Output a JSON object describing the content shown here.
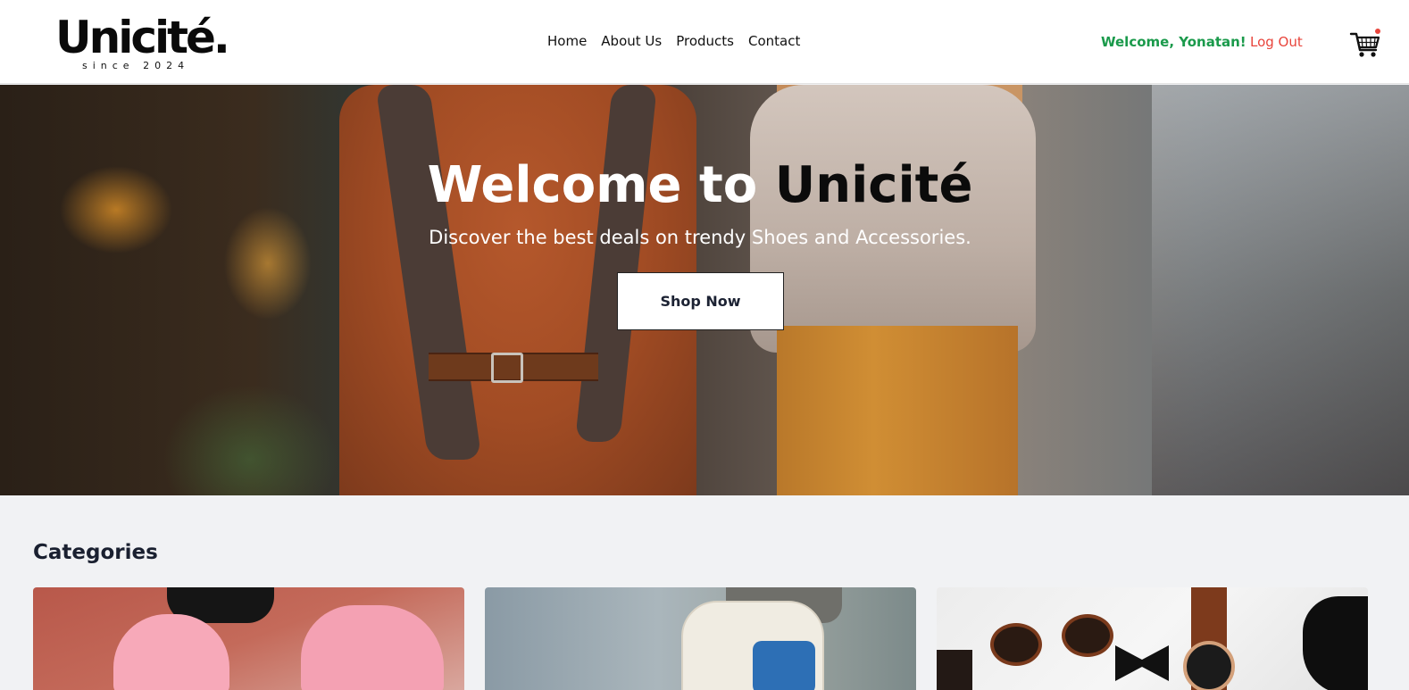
{
  "header": {
    "logo_main": "Unicité.",
    "logo_sub": "since 2024",
    "nav": [
      "Home",
      "About Us",
      "Products",
      "Contact"
    ],
    "welcome": "Welcome, Yonatan!",
    "logout": "Log Out",
    "cart_icon": "shopping-cart-icon"
  },
  "hero": {
    "title_prefix": "Welcome to ",
    "title_brand": "Unicité",
    "subtitle": "Discover the best deals on trendy Shoes and Accessories.",
    "cta": "Shop Now"
  },
  "categories": {
    "title": "Categories"
  },
  "colors": {
    "welcome_green": "#1a9a4b",
    "logout_red": "#e8443b",
    "page_bg": "#f1f2f4"
  }
}
